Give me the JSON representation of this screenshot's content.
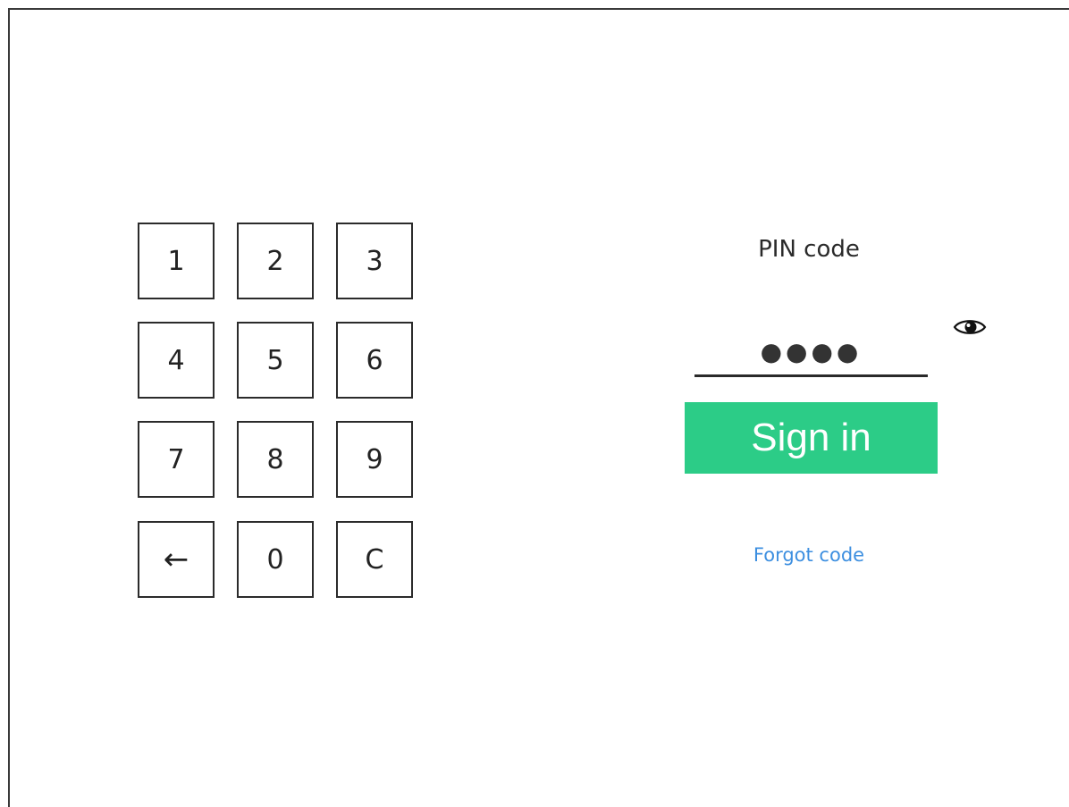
{
  "keypad": {
    "keys": [
      {
        "label": "1",
        "name": "key-1"
      },
      {
        "label": "2",
        "name": "key-2"
      },
      {
        "label": "3",
        "name": "key-3"
      },
      {
        "label": "4",
        "name": "key-4"
      },
      {
        "label": "5",
        "name": "key-5"
      },
      {
        "label": "6",
        "name": "key-6"
      },
      {
        "label": "7",
        "name": "key-7"
      },
      {
        "label": "8",
        "name": "key-8"
      },
      {
        "label": "9",
        "name": "key-9"
      },
      {
        "label": "←",
        "name": "backspace-key",
        "icon": "left-arrow-icon"
      },
      {
        "label": "0",
        "name": "key-0"
      },
      {
        "label": "C",
        "name": "clear-key"
      }
    ]
  },
  "pin": {
    "title": "PIN code",
    "masked_value": "●●●●",
    "reveal_icon": "eye-icon"
  },
  "signin": {
    "label": "Sign in"
  },
  "forgot": {
    "label": "Forgot code"
  },
  "colors": {
    "accent": "#2ccc87",
    "link": "#3d8fe0",
    "text": "#2a2a2a"
  }
}
